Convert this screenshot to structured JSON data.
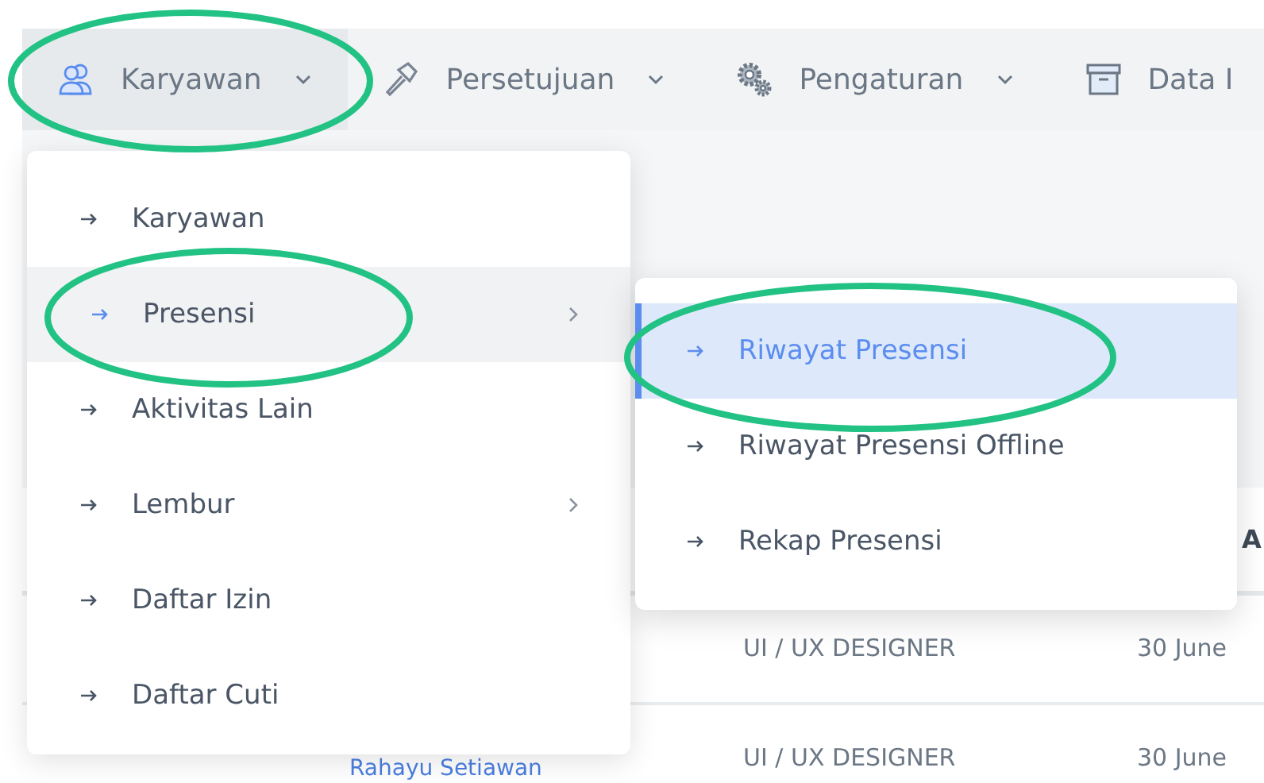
{
  "nav": [
    {
      "label": "Karyawan",
      "selected": true,
      "caret": true
    },
    {
      "label": "Persetujuan",
      "selected": false,
      "caret": true
    },
    {
      "label": "Pengaturan",
      "selected": false,
      "caret": true
    },
    {
      "label": "Data I",
      "selected": false,
      "caret": false
    }
  ],
  "menu": [
    {
      "label": "Karyawan",
      "expanded": false,
      "submenu": false
    },
    {
      "label": "Presensi",
      "expanded": true,
      "submenu": true
    },
    {
      "label": "Aktivitas Lain",
      "expanded": false,
      "submenu": false
    },
    {
      "label": "Lembur",
      "expanded": false,
      "submenu": true
    },
    {
      "label": "Daftar Izin",
      "expanded": false,
      "submenu": false
    },
    {
      "label": "Daftar Cuti",
      "expanded": false,
      "submenu": false
    }
  ],
  "submenu": [
    {
      "label": "Riwayat Presensi",
      "selected": true
    },
    {
      "label": "Riwayat Presensi Offline",
      "selected": false
    },
    {
      "label": "Rekap Presensi",
      "selected": false
    }
  ],
  "table": {
    "column_4": "A",
    "rows": [
      {
        "position": "UI / UX DESIGNER",
        "date": "30 June"
      },
      {
        "name": "Rahayu Setiawan",
        "position": "UI / UX DESIGNER",
        "date": "30 June"
      }
    ]
  }
}
